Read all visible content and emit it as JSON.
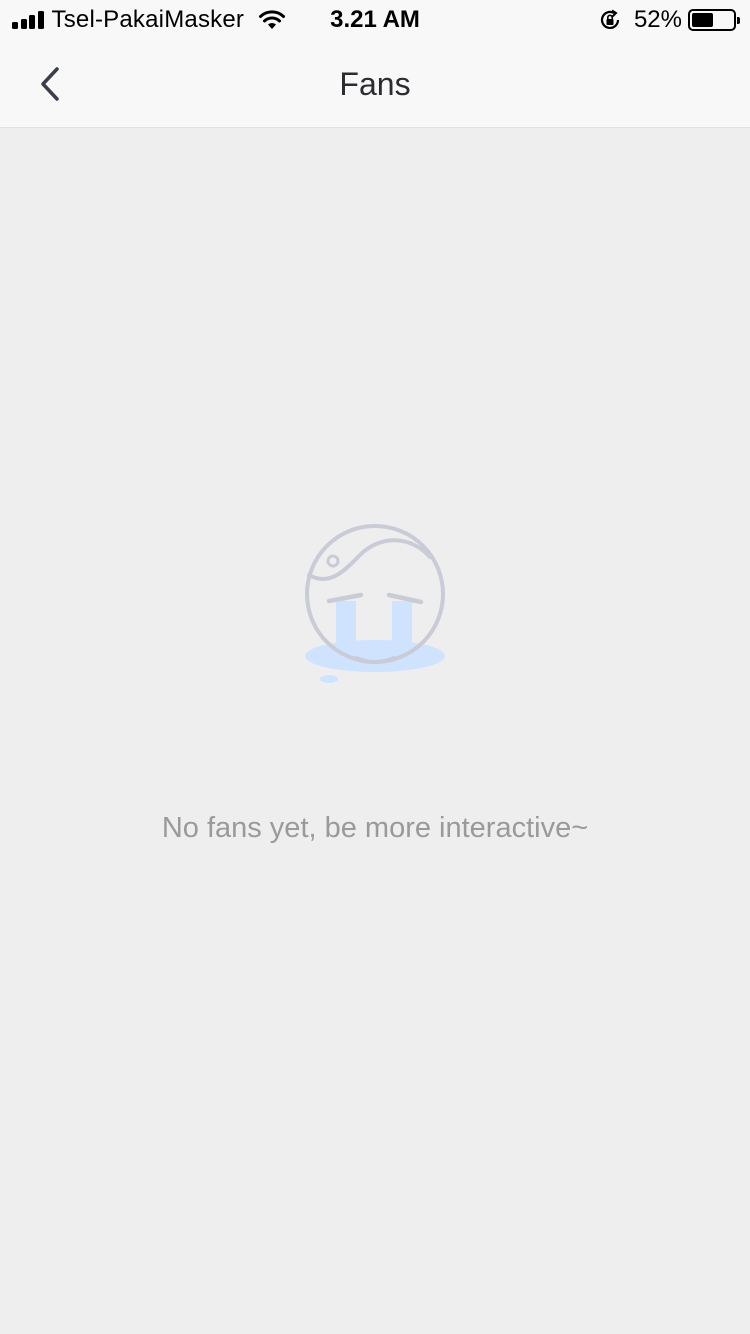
{
  "status_bar": {
    "carrier": "Tsel-PakaiMasker",
    "time": "3.21 AM",
    "battery_percent_text": "52%",
    "battery_level": 0.52,
    "signal_bars": 4
  },
  "nav": {
    "title": "Fans",
    "back_icon": "chevron-left-icon"
  },
  "empty_state": {
    "icon": "crying-face-icon",
    "message": "No fans yet, be more interactive~",
    "colors": {
      "outline": "#c9ccd6",
      "tears": "#cfe3ff"
    }
  },
  "colors": {
    "background": "#eeeeee",
    "bar_background": "#f8f8f8",
    "title_text": "#2b2b30",
    "message_text": "#9a9a9a"
  }
}
